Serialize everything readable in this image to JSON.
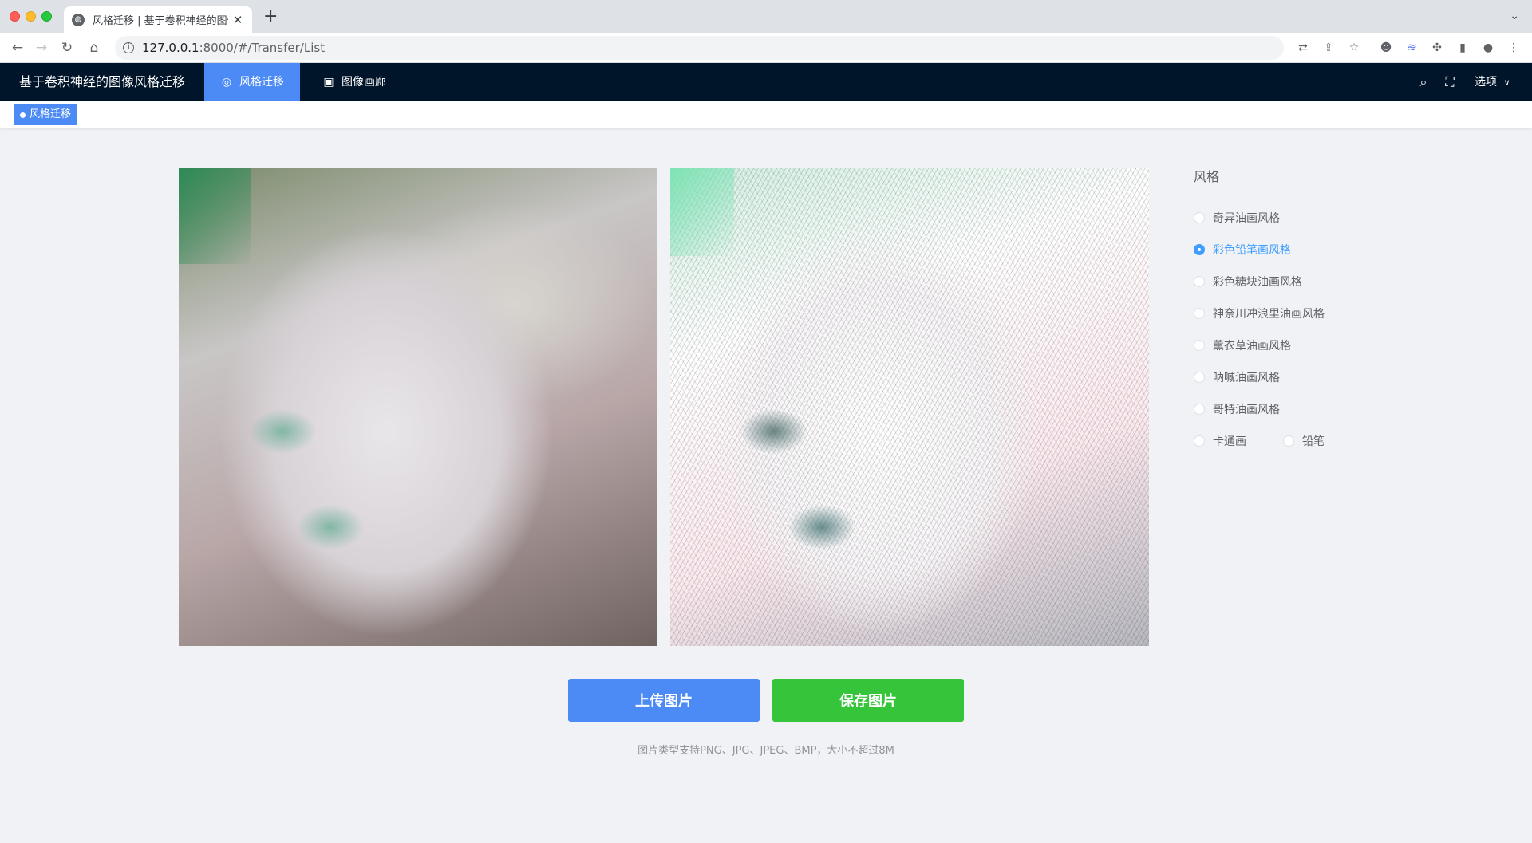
{
  "browser": {
    "tab_title": "风格迁移 | 基于卷积神经的图像风格迁移",
    "url_host": "127.0.0.1",
    "url_path": ":8000/#/Transfer/List"
  },
  "header": {
    "app_title": "基于卷积神经的图像风格迁移",
    "tabs": [
      {
        "label": "风格迁移",
        "icon": "style-transfer-icon",
        "active": true
      },
      {
        "label": "图像画廊",
        "icon": "image-gallery-icon",
        "active": false
      }
    ],
    "options_label": "选项"
  },
  "tags_view": {
    "active_tag": "风格迁移"
  },
  "style_panel": {
    "title": "风格",
    "options": [
      {
        "label": "奇异油画风格",
        "checked": false
      },
      {
        "label": "彩色铅笔画风格",
        "checked": true
      },
      {
        "label": "彩色糖块油画风格",
        "checked": false
      },
      {
        "label": "神奈川冲浪里油画风格",
        "checked": false
      },
      {
        "label": "薰衣草油画风格",
        "checked": false
      },
      {
        "label": "呐喊油画风格",
        "checked": false
      },
      {
        "label": "哥特油画风格",
        "checked": false
      },
      {
        "label": "卡通画",
        "checked": false
      },
      {
        "label": "铅笔",
        "checked": false
      }
    ]
  },
  "actions": {
    "upload_label": "上传图片",
    "save_label": "保存图片",
    "hint": "图片类型支持PNG、JPG、JPEG、BMP，大小不超过8M"
  },
  "colors": {
    "header_bg": "#001529",
    "accent_blue": "#4c8bf5",
    "save_green": "#36c43a",
    "radio_checked": "#409eff"
  }
}
